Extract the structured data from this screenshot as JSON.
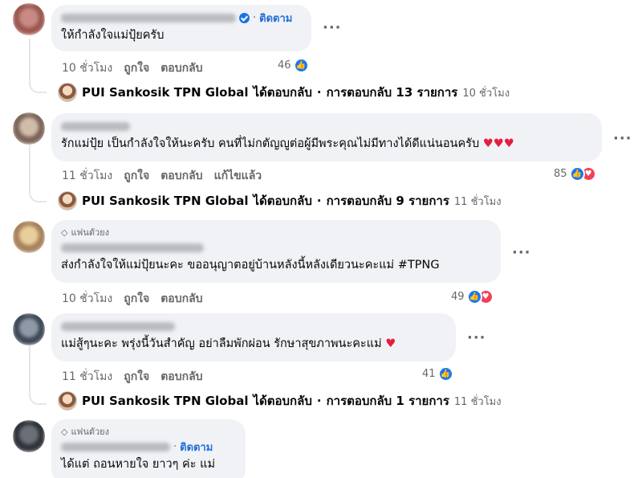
{
  "comments": [
    {
      "follow_label": "ติดตาม",
      "text": "ให้กำลังใจแม่ปุ้ยครับ",
      "time": "10 ชั่วโมง",
      "like_label": "ถูกใจ",
      "reply_label": "ตอบกลับ",
      "reaction_count": "46",
      "more_label": "···"
    },
    {
      "text": "รักแม่ปุ้ย เป็นกำลังใจให้นะครับ คนที่ไม่กตัญญูต่อผู้มีพระคุณไม่มีทางได้ดีแน่นอนครับ",
      "hearts": "♥♥♥",
      "time": "11 ชั่วโมง",
      "like_label": "ถูกใจ",
      "reply_label": "ตอบกลับ",
      "edited_label": "แก้ไขแล้ว",
      "reaction_count": "85",
      "more_label": "···"
    },
    {
      "badge": "แฟนตัวยง",
      "text": "ส่งกำลังใจให้แม่ปุ้ยนะคะ ขออนุญาตอยู่บ้านหลังนี้หลังเดียวนะคะแม่ #TPNG",
      "time": "10 ชั่วโมง",
      "like_label": "ถูกใจ",
      "reply_label": "ตอบกลับ",
      "reaction_count": "49",
      "more_label": "···"
    },
    {
      "text": "แม่สู้ๆนะคะ พรุ่งนี้วันสำคัญ อย่าลืมพักผ่อน รักษาสุขภาพนะคะแม่",
      "hearts": "♥",
      "time": "11 ชั่วโมง",
      "like_label": "ถูกใจ",
      "reply_label": "ตอบกลับ",
      "reaction_count": "41",
      "more_label": "···"
    },
    {
      "badge": "แฟนตัวยง",
      "follow_label": "ติดตาม",
      "text": "ได้แต่ ถอนหายใจ ยาวๆ ค่ะ แม่"
    }
  ],
  "replies": [
    {
      "name": "PUI Sankosik TPN Global",
      "verb": "ได้ตอบกลับ",
      "sep": "·",
      "count": "การตอบกลับ 13 รายการ",
      "time": "10 ชั่วโมง"
    },
    {
      "name": "PUI Sankosik TPN Global",
      "verb": "ได้ตอบกลับ",
      "sep": "·",
      "count": "การตอบกลับ 9 รายการ",
      "time": "11 ชั่วโมง"
    },
    {
      "name": "PUI Sankosik TPN Global",
      "verb": "ได้ตอบกลับ",
      "sep": "·",
      "count": "การตอบกลับ 1 รายการ",
      "time": "11 ชั่วโมง"
    }
  ],
  "icons": {
    "like": "thumbs-up-icon",
    "love": "heart-icon",
    "verified": "verified-badge-icon",
    "gem": "diamond-icon"
  },
  "colors": {
    "accent": "#216fdb",
    "like": "#1877f2",
    "love": "#f33e58",
    "bubble": "#f0f2f5"
  }
}
